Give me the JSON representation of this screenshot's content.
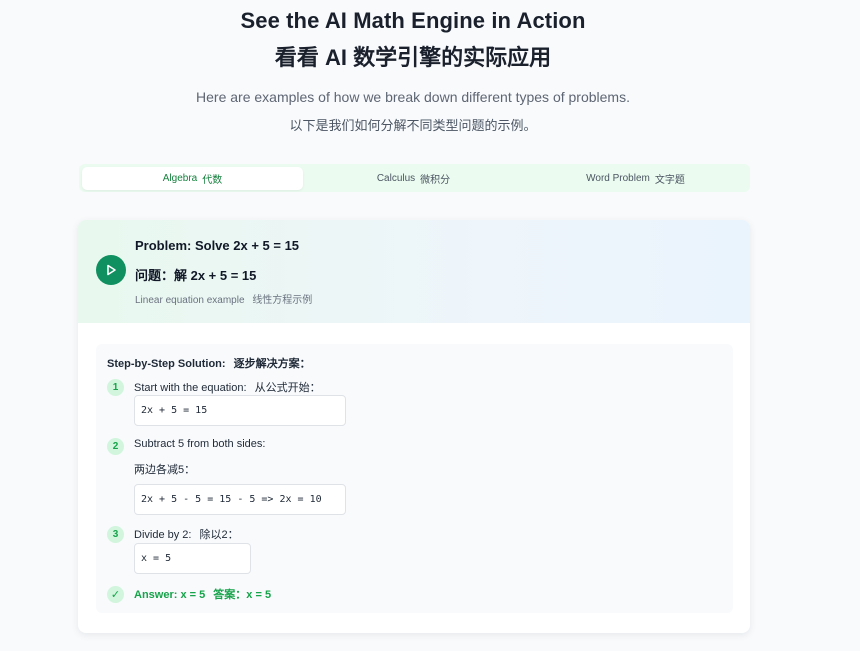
{
  "header": {
    "title_en": "See the AI Math Engine in Action",
    "title_zh": "看看 AI 数学引擎的实际应用",
    "subtitle_en": "Here are examples of how we break down different types of problems.",
    "subtitle_zh": "以下是我们如何分解不同类型问题的示例。"
  },
  "tabs": [
    {
      "label_en": "Algebra",
      "label_zh": "代数",
      "active": true
    },
    {
      "label_en": "Calculus",
      "label_zh": "微积分",
      "active": false
    },
    {
      "label_en": "Word Problem",
      "label_zh": "文字题",
      "active": false
    }
  ],
  "problem": {
    "title_en": "Problem: Solve 2x + 5 = 15",
    "title_zh": "问题：解 2x + 5 = 15",
    "desc_en": "Linear equation example",
    "desc_zh": "线性方程示例",
    "play_icon": "play-icon"
  },
  "solution": {
    "title_en": "Step-by-Step Solution:",
    "title_zh": "逐步解决方案：",
    "steps": [
      {
        "num": "1",
        "text_en": "Start with the equation:",
        "text_zh": "从公式开始：",
        "code": "2x + 5 = 15"
      },
      {
        "num": "2",
        "text_en": "Subtract 5 from both sides:",
        "text_zh": "两边各减5：",
        "code": "2x + 5 - 5 = 15 - 5 => 2x = 10"
      },
      {
        "num": "3",
        "text_en": "Divide by 2:",
        "text_zh": "除以2：",
        "code": "x = 5"
      }
    ],
    "answer_en": "Answer: x = 5",
    "answer_zh": "答案：x = 5",
    "answer_icon": "✓"
  },
  "colors": {
    "accent": "#109060",
    "tab_bg": "#ebfbef",
    "answer": "#16a34a"
  }
}
